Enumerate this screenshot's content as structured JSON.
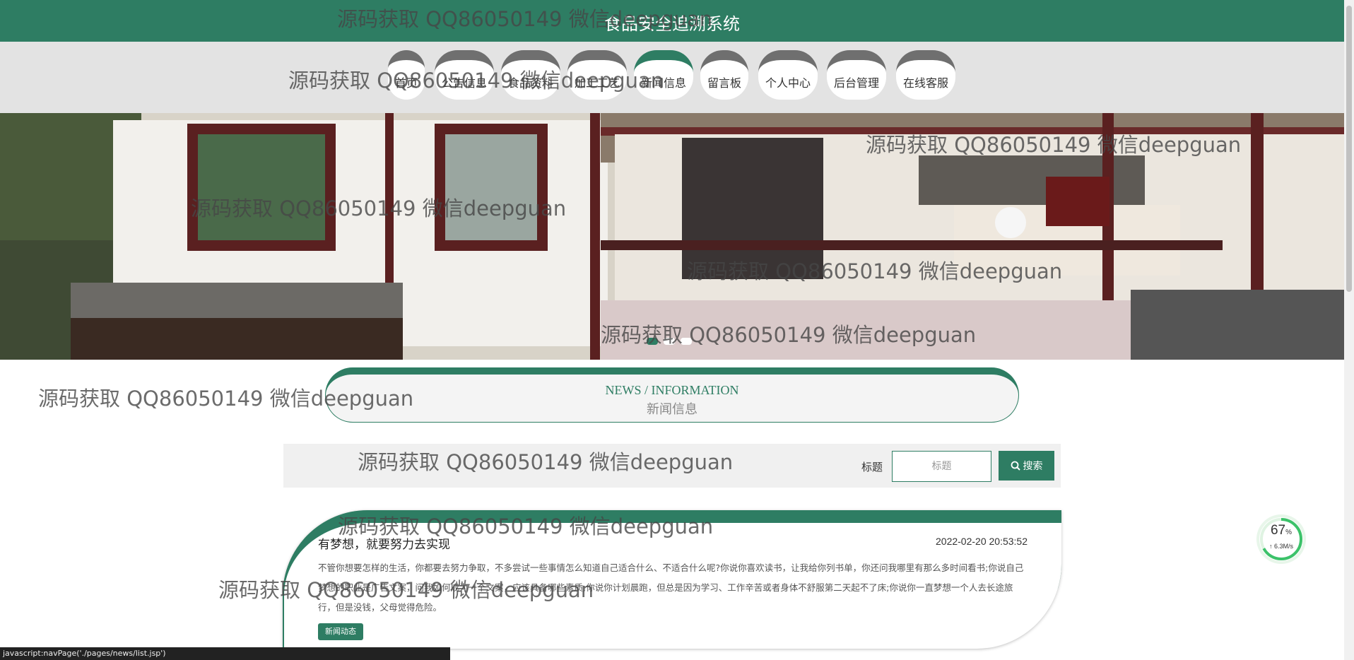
{
  "header": {
    "title": "食品安全追溯系统"
  },
  "nav": {
    "items": [
      {
        "label": "首页"
      },
      {
        "label": "公告信息"
      },
      {
        "label": "食品资料"
      },
      {
        "label": "加工工艺"
      },
      {
        "label": "新闻信息"
      },
      {
        "label": "留言板"
      },
      {
        "label": "个人中心"
      },
      {
        "label": "后台管理"
      },
      {
        "label": "在线客服"
      }
    ],
    "active_index": 4
  },
  "banner": {
    "slide_count": 3,
    "active_slide": 0
  },
  "section": {
    "title_en": "NEWS / INFORMATION",
    "title_cn": "新闻信息"
  },
  "search": {
    "label": "标题",
    "placeholder": "标题",
    "button_label": "搜索"
  },
  "news": [
    {
      "title": "有梦想，就要努力去实现",
      "time": "2022-02-20 20:53:52",
      "body": "不管你想要怎样的生活，你都要去努力争取，不多尝试一些事情怎么知道自己适合什么、不适合什么呢?你说你喜欢读书，让我给你列书单，你还问我哪里有那么多时间看书;你说自己梦想的职业是广告文案，问我如何成为一个文案，应该具备哪些素质;你说你计划晨跑，但总是因为学习、工作辛苦或者身体不舒服第二天起不了床;你说你一直梦想一个人去长途旅行，但是没钱，父母觉得危险。",
      "tag": "新闻动态"
    }
  ],
  "watermark": {
    "text": "源码获取 QQ86050149 微信deepguan"
  },
  "speed_widget": {
    "percent": "67",
    "percent_unit": "%",
    "rate": "↑ 6.3M/s"
  },
  "status_bar": {
    "text": "javascript:navPage('./pages/news/list.jsp')"
  },
  "colors": {
    "primary": "#2e7d63",
    "nav_bg": "#e3e3e3",
    "inactive_tab": "#6f6f6f"
  }
}
